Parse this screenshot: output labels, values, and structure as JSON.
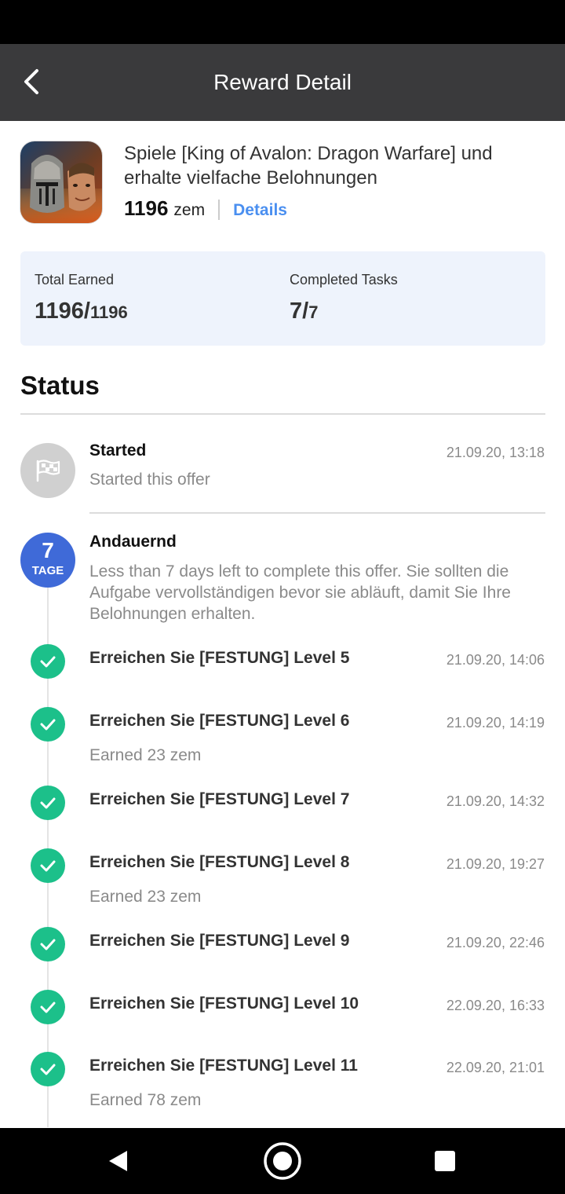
{
  "header": {
    "title": "Reward Detail",
    "back_icon": "chevron-left-icon"
  },
  "offer": {
    "title": "Spiele [King of Avalon: Dragon Warfare] und erhalte vielfache Belohnungen",
    "amount": "1196",
    "unit": "zem",
    "details_label": "Details"
  },
  "stats": {
    "total_earned_label": "Total Earned",
    "total_earned_value": "1196/",
    "total_earned_total": "1196",
    "completed_label": "Completed Tasks",
    "completed_value": "7/",
    "completed_total": "7"
  },
  "status": {
    "heading": "Status",
    "started": {
      "title": "Started",
      "subtitle": "Started this offer",
      "time": "21.09.20, 13:18",
      "icon": "flag-icon"
    },
    "ongoing": {
      "badge_number": "7",
      "badge_unit": "TAGE",
      "title": "Andauernd",
      "description": "Less than 7 days left to complete this offer. Sie sollten die Aufgabe vervollständigen bevor sie abläuft, damit Sie Ihre Belohnungen erhalten."
    },
    "tasks": [
      {
        "title": "Erreichen Sie [FESTUNG] Level 5",
        "time": "21.09.20, 14:06",
        "earned": ""
      },
      {
        "title": "Erreichen Sie [FESTUNG] Level 6",
        "time": "21.09.20, 14:19",
        "earned": "Earned 23 zem"
      },
      {
        "title": "Erreichen Sie [FESTUNG] Level 7",
        "time": "21.09.20, 14:32",
        "earned": ""
      },
      {
        "title": "Erreichen Sie [FESTUNG] Level 8",
        "time": "21.09.20, 19:27",
        "earned": "Earned 23 zem"
      },
      {
        "title": "Erreichen Sie [FESTUNG] Level 9",
        "time": "21.09.20, 22:46",
        "earned": ""
      },
      {
        "title": "Erreichen Sie [FESTUNG] Level 10",
        "time": "22.09.20, 16:33",
        "earned": ""
      },
      {
        "title": "Erreichen Sie [FESTUNG] Level 11",
        "time": "22.09.20, 21:01",
        "earned": "Earned 78 zem"
      }
    ]
  },
  "colors": {
    "appbar": "#3a3a3c",
    "accent_link": "#4a8ff0",
    "badge": "#3f6ad8",
    "check": "#1cc08a",
    "stats_bg": "#eef3fc"
  },
  "navigation": {
    "back_icon": "back-triangle-icon",
    "home_icon": "home-circle-icon",
    "recents_icon": "recents-square-icon"
  }
}
